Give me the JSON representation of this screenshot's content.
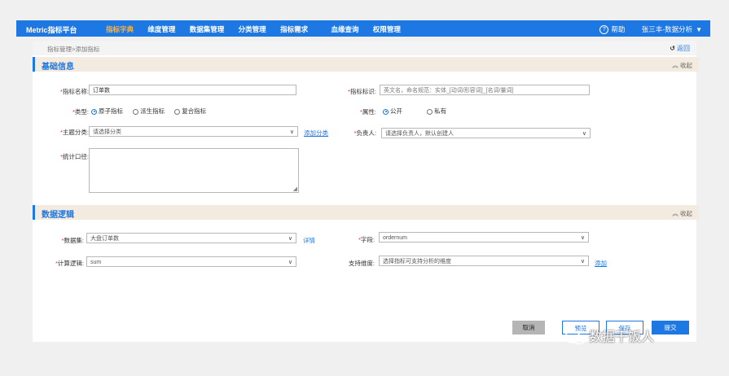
{
  "brand": "Metric指标平台",
  "nav": {
    "items": [
      "指标字典",
      "维度管理",
      "数据集管理",
      "分类管理",
      "指标需求",
      "血缘查询",
      "权限管理"
    ],
    "active_index": 0
  },
  "header_right": {
    "help": "帮助",
    "user": "张三丰-数据分析"
  },
  "breadcrumb": "指标管理>添加指标",
  "back": "返回",
  "sections": {
    "basic": {
      "title": "基础信息",
      "collapse": "收起"
    },
    "logic": {
      "title": "数据逻辑",
      "collapse": "收起"
    }
  },
  "fields": {
    "name": {
      "label": "指标名称:",
      "value": "订单数"
    },
    "identifier": {
      "label": "指标标识:",
      "placeholder": "英文名，命名规范：实体_[动词/形容词]_[名词/量词]"
    },
    "type": {
      "label": "类型:",
      "options": [
        "原子指标",
        "派生指标",
        "复合指标"
      ],
      "selected": 0
    },
    "attribute": {
      "label": "属性:",
      "options": [
        "公开",
        "私有"
      ],
      "selected": 0
    },
    "subject": {
      "label": "主题分类:",
      "placeholder": "请选择分类",
      "add_link": "添加分类"
    },
    "owner": {
      "label": "负责人:",
      "placeholder": "请选择负责人，默认创建人"
    },
    "caliber": {
      "label": "统计口径:"
    },
    "dataset": {
      "label": "数据集:",
      "value": "大盘订单数",
      "detail_link": "详情"
    },
    "field": {
      "label": "字段:",
      "value": "ordernum"
    },
    "logic": {
      "label": "计算逻辑:",
      "value": "sum"
    },
    "dimension": {
      "label": "支持维度:",
      "placeholder": "选择指标可支持分析的维度",
      "add_link": "添加"
    }
  },
  "buttons": {
    "cancel": "取消",
    "preview": "预览",
    "save": "保存",
    "submit": "提交"
  },
  "watermark": "数据干饭人",
  "colors": {
    "primary": "#1e78e3",
    "active_nav": "#f6b54a",
    "section_bg": "#f3ebdf",
    "required": "#e03030"
  },
  "icons": [
    "help-icon",
    "chevron-down-icon",
    "back-arrow-icon",
    "collapse-icon",
    "resize-grip-icon",
    "wechat-icon"
  ]
}
